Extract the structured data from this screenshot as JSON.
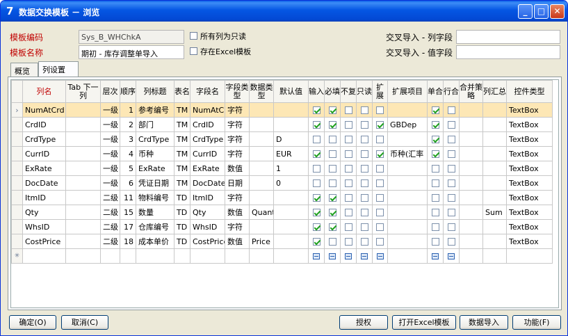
{
  "window": {
    "app_icon": "7",
    "title": "数据交换模板 － 浏览",
    "min": "_",
    "max": "□",
    "close": "✕"
  },
  "form": {
    "code_label": "模板编码",
    "code_value": "Sys_B_WHChkA",
    "name_label": "模板名称",
    "name_value": "期初 - 库存调整单导入",
    "readonly_label": "所有列为只读",
    "excel_label": "存在Excel模板",
    "cross_col_label": "交叉导入 - 列字段",
    "cross_col_value": "",
    "cross_val_label": "交叉导入 - 值字段",
    "cross_val_value": ""
  },
  "tabs": [
    "概览",
    "列设置"
  ],
  "grid": {
    "headers": [
      "列名",
      "Tab 下一列",
      "层次",
      "顺序",
      "列标题",
      "表名",
      "字段名",
      "字段类型",
      "数据类型",
      "默认值",
      "输入",
      "必填",
      "不复",
      "只读",
      "扩展",
      "扩展项目",
      "单合",
      "行合",
      "合并策略",
      "列汇总",
      "控件类型"
    ],
    "rows": [
      {
        "c": [
          "NumAtCrd",
          "",
          "一级",
          "1",
          "参考编号",
          "TM",
          "NumAtCr",
          "字符",
          "",
          "",
          "",
          "",
          "",
          "",
          "",
          "",
          "",
          "",
          "",
          "",
          "TextBox"
        ],
        "k": [
          1,
          1,
          0,
          0,
          0,
          1,
          0
        ]
      },
      {
        "c": [
          "CrdID",
          "",
          "一级",
          "2",
          "部门",
          "TM",
          "CrdID",
          "字符",
          "",
          "",
          "",
          "",
          "",
          "",
          "",
          "GBDep",
          "",
          "",
          "",
          "",
          "TextBox"
        ],
        "k": [
          1,
          1,
          0,
          0,
          1,
          1,
          0
        ]
      },
      {
        "c": [
          "CrdType",
          "",
          "一级",
          "3",
          "CrdType",
          "TM",
          "CrdType",
          "字符",
          "",
          "D",
          "",
          "",
          "",
          "",
          "",
          "",
          "",
          "",
          "",
          "",
          "TextBox"
        ],
        "k": [
          0,
          0,
          0,
          0,
          0,
          1,
          0
        ]
      },
      {
        "c": [
          "CurrID",
          "",
          "一级",
          "4",
          "币种",
          "TM",
          "CurrID",
          "字符",
          "",
          "EUR",
          "",
          "",
          "",
          "",
          "",
          "币种(汇率",
          "",
          "",
          "",
          "",
          "TextBox"
        ],
        "k": [
          1,
          0,
          0,
          0,
          1,
          1,
          0
        ]
      },
      {
        "c": [
          "ExRate",
          "",
          "一级",
          "5",
          "ExRate",
          "TM",
          "ExRate",
          "数值",
          "",
          "1",
          "",
          "",
          "",
          "",
          "",
          "",
          "",
          "",
          "",
          "",
          "TextBox"
        ],
        "k": [
          0,
          0,
          0,
          0,
          0,
          0,
          0
        ]
      },
      {
        "c": [
          "DocDate",
          "",
          "一级",
          "6",
          "凭证日期",
          "TM",
          "DocDate",
          "日期",
          "",
          "0",
          "",
          "",
          "",
          "",
          "",
          "",
          "",
          "",
          "",
          "",
          "TextBox"
        ],
        "k": [
          0,
          0,
          0,
          0,
          0,
          0,
          0
        ]
      },
      {
        "c": [
          "ItmID",
          "",
          "二级",
          "11",
          "物料编号",
          "TD",
          "ItmID",
          "字符",
          "",
          "",
          "",
          "",
          "",
          "",
          "",
          "",
          "",
          "",
          "",
          "",
          "TextBox"
        ],
        "k": [
          1,
          1,
          0,
          0,
          0,
          0,
          0
        ]
      },
      {
        "c": [
          "Qty",
          "",
          "二级",
          "15",
          "数量",
          "TD",
          "Qty",
          "数值",
          "Quant",
          "",
          "",
          "",
          "",
          "",
          "",
          "",
          "",
          "",
          "",
          "Sum",
          "TextBox"
        ],
        "k": [
          1,
          1,
          0,
          0,
          0,
          0,
          0
        ]
      },
      {
        "c": [
          "WhsID",
          "",
          "二级",
          "17",
          "仓库编号",
          "TD",
          "WhsID",
          "字符",
          "",
          "",
          "",
          "",
          "",
          "",
          "",
          "",
          "",
          "",
          "",
          "",
          "TextBox"
        ],
        "k": [
          1,
          1,
          0,
          0,
          0,
          0,
          0
        ]
      },
      {
        "c": [
          "CostPrice",
          "",
          "二级",
          "18",
          "成本单价",
          "TD",
          "CostPrice",
          "数值",
          "Price",
          "",
          "",
          "",
          "",
          "",
          "",
          "",
          "",
          "",
          "",
          "",
          "TextBox"
        ],
        "k": [
          1,
          0,
          0,
          0,
          0,
          0,
          0
        ]
      }
    ]
  },
  "buttons": {
    "ok": "确定(O)",
    "cancel": "取消(C)",
    "auth": "授权",
    "open_excel": "打开Excel模板",
    "import": "数据导入",
    "func": "功能(F)"
  }
}
